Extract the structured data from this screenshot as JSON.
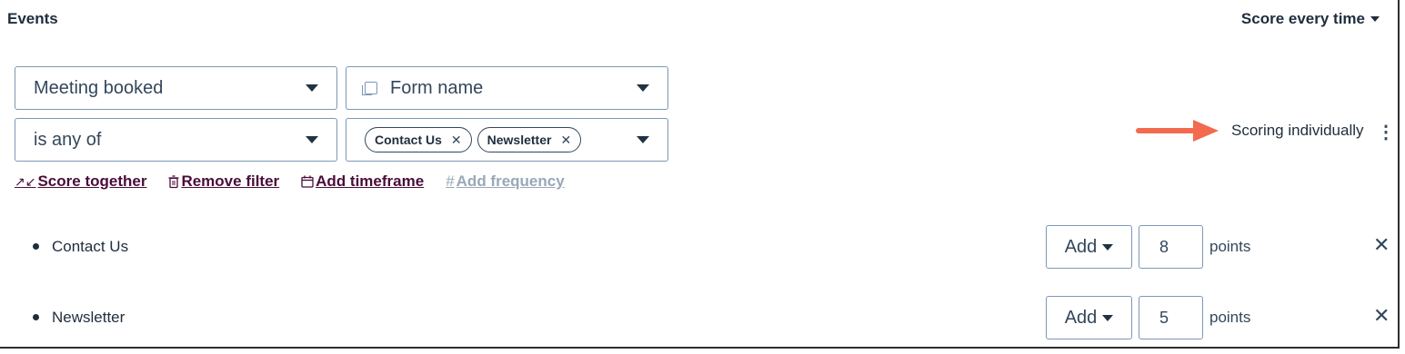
{
  "header": {
    "title": "Events",
    "score_mode": "Score every time"
  },
  "filters": {
    "event_select": "Meeting booked",
    "property_select": "Form name",
    "operator_select": "is any of",
    "values": [
      {
        "label": "Contact Us"
      },
      {
        "label": "Newsletter"
      }
    ]
  },
  "actions": {
    "score_together": "Score together",
    "remove_filter": "Remove filter",
    "add_timeframe": "Add timeframe",
    "add_frequency": "Add frequency"
  },
  "scoring": {
    "status": "Scoring individually",
    "arrow_color": "#f26b4f"
  },
  "rows": [
    {
      "label": "Contact Us",
      "action": "Add",
      "points_value": "8",
      "points_unit": "points"
    },
    {
      "label": "Newsletter",
      "action": "Add",
      "points_value": "5",
      "points_unit": "points"
    }
  ],
  "icons": {
    "form": "form-icon",
    "collapse": "collapse-arrows-icon",
    "trash": "trash-icon",
    "calendar": "calendar-icon",
    "hash": "hash-icon",
    "more": "kebab-menu-icon",
    "close": "close-icon"
  },
  "colors": {
    "link": "#4a0d3a",
    "disabled_link": "#99a8b8",
    "border": "#7c98b6",
    "text": "#33475b"
  }
}
